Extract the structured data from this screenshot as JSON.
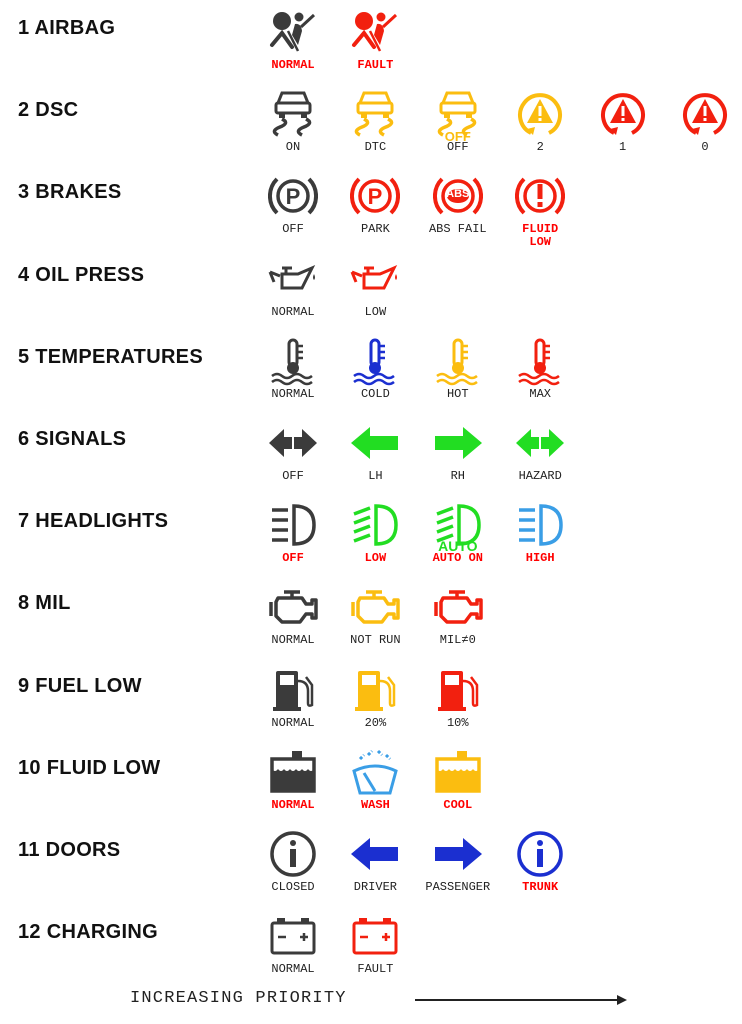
{
  "colors": {
    "dark": "#3b3b3b",
    "red": "#f2200f",
    "yellow": "#fbbd10",
    "green": "#22dd22",
    "blue": "#1b2fd0",
    "lightblue": "#3a9ee6",
    "label_red": "#ff0000",
    "label_dark": "#222222"
  },
  "rows": [
    {
      "title": "1 AIRBAG",
      "items": [
        {
          "icon": "airbag",
          "color": "dark",
          "label": "NORMAL",
          "label_color": "label_red"
        },
        {
          "icon": "airbag",
          "color": "red",
          "label": "FAULT",
          "label_color": "label_red"
        }
      ]
    },
    {
      "title": "2 DSC",
      "items": [
        {
          "icon": "dsc-car",
          "color": "dark",
          "label": "ON",
          "label_color": "label_dark"
        },
        {
          "icon": "dsc-car",
          "color": "yellow",
          "label": "DTC",
          "label_color": "label_dark"
        },
        {
          "icon": "dsc-car-off",
          "color": "yellow",
          "badge": "OFF",
          "label": "OFF",
          "label_color": "label_dark"
        },
        {
          "icon": "stability-warning",
          "color": "yellow",
          "label": "2",
          "label_color": "label_dark"
        },
        {
          "icon": "stability-warning",
          "color": "red",
          "label": "1",
          "label_color": "label_dark"
        },
        {
          "icon": "stability-warning",
          "color": "red",
          "label": "0",
          "label_color": "label_dark"
        }
      ]
    },
    {
      "title": "3 BRAKES",
      "items": [
        {
          "icon": "brake-park",
          "color": "dark",
          "label": "OFF",
          "label_color": "label_dark"
        },
        {
          "icon": "brake-park",
          "color": "red",
          "label": "PARK",
          "label_color": "label_dark"
        },
        {
          "icon": "brake-abs",
          "color": "red",
          "badge": "ABS",
          "label": "ABS FAIL",
          "label_color": "label_dark"
        },
        {
          "icon": "brake-warning",
          "color": "red",
          "label": "FLUID\nLOW",
          "label_color": "label_red"
        }
      ]
    },
    {
      "title": "4 OIL PRESS",
      "items": [
        {
          "icon": "oil-can",
          "color": "dark",
          "label": "NORMAL",
          "label_color": "label_dark"
        },
        {
          "icon": "oil-can",
          "color": "red",
          "label": "LOW",
          "label_color": "label_dark"
        }
      ]
    },
    {
      "title": "5 TEMPERATURES",
      "items": [
        {
          "icon": "thermometer",
          "color": "dark",
          "label": "NORMAL",
          "label_color": "label_dark"
        },
        {
          "icon": "thermometer",
          "color": "blue",
          "label": "COLD",
          "label_color": "label_dark"
        },
        {
          "icon": "thermometer",
          "color": "yellow",
          "label": "HOT",
          "label_color": "label_dark"
        },
        {
          "icon": "thermometer",
          "color": "red",
          "label": "MAX",
          "label_color": "label_dark"
        }
      ]
    },
    {
      "title": "6 SIGNALS",
      "items": [
        {
          "icon": "arrows-both",
          "color": "dark",
          "label": "OFF",
          "label_color": "label_dark"
        },
        {
          "icon": "arrow-left",
          "color": "green",
          "label": "LH",
          "label_color": "label_dark"
        },
        {
          "icon": "arrow-right",
          "color": "green",
          "label": "RH",
          "label_color": "label_dark"
        },
        {
          "icon": "arrows-both",
          "color": "green",
          "label": "HAZARD",
          "label_color": "label_dark"
        }
      ]
    },
    {
      "title": "7 HEADLIGHTS",
      "items": [
        {
          "icon": "headlight-high",
          "color": "dark",
          "label": "OFF",
          "label_color": "label_red"
        },
        {
          "icon": "headlight-low",
          "color": "green",
          "label": "LOW",
          "label_color": "label_red"
        },
        {
          "icon": "headlight-low-auto",
          "color": "green",
          "badge": "AUTO",
          "label": "AUTO ON",
          "label_color": "label_red"
        },
        {
          "icon": "headlight-high",
          "color": "lightblue",
          "label": "HIGH",
          "label_color": "label_red"
        }
      ]
    },
    {
      "title": "8 MIL",
      "items": [
        {
          "icon": "engine",
          "color": "dark",
          "label": "NORMAL",
          "label_color": "label_dark"
        },
        {
          "icon": "engine",
          "color": "yellow",
          "label": "NOT RUN",
          "label_color": "label_dark"
        },
        {
          "icon": "engine",
          "color": "red",
          "label": "MIL≠0",
          "label_color": "label_dark"
        }
      ]
    },
    {
      "title": "9 FUEL LOW",
      "items": [
        {
          "icon": "fuel-pump",
          "color": "dark",
          "label": "NORMAL",
          "label_color": "label_dark"
        },
        {
          "icon": "fuel-pump",
          "color": "yellow",
          "label": "20%",
          "label_color": "label_dark"
        },
        {
          "icon": "fuel-pump",
          "color": "red",
          "label": "10%",
          "label_color": "label_dark"
        }
      ]
    },
    {
      "title": "10 FLUID LOW",
      "items": [
        {
          "icon": "fluid-tank",
          "color": "dark",
          "label": "NORMAL",
          "label_color": "label_red"
        },
        {
          "icon": "washer",
          "color": "lightblue",
          "label": "WASH",
          "label_color": "label_red"
        },
        {
          "icon": "fluid-tank",
          "color": "yellow",
          "label": "COOL",
          "label_color": "label_red"
        }
      ]
    },
    {
      "title": "11 DOORS",
      "items": [
        {
          "icon": "info-circle",
          "color": "dark",
          "label": "CLOSED",
          "label_color": "label_dark"
        },
        {
          "icon": "arrow-left",
          "color": "blue",
          "label": "DRIVER",
          "label_color": "label_dark"
        },
        {
          "icon": "arrow-right",
          "color": "blue",
          "label": "PASSENGER",
          "label_color": "label_dark"
        },
        {
          "icon": "info-circle",
          "color": "blue",
          "label": "TRUNK",
          "label_color": "label_red"
        }
      ]
    },
    {
      "title": "12 CHARGING",
      "items": [
        {
          "icon": "battery",
          "color": "dark",
          "label": "NORMAL",
          "label_color": "label_dark"
        },
        {
          "icon": "battery",
          "color": "red",
          "label": "FAULT",
          "label_color": "label_dark"
        }
      ]
    }
  ],
  "footer": {
    "label": "INCREASING PRIORITY",
    "arrow_icon": "arrow-right-long"
  }
}
